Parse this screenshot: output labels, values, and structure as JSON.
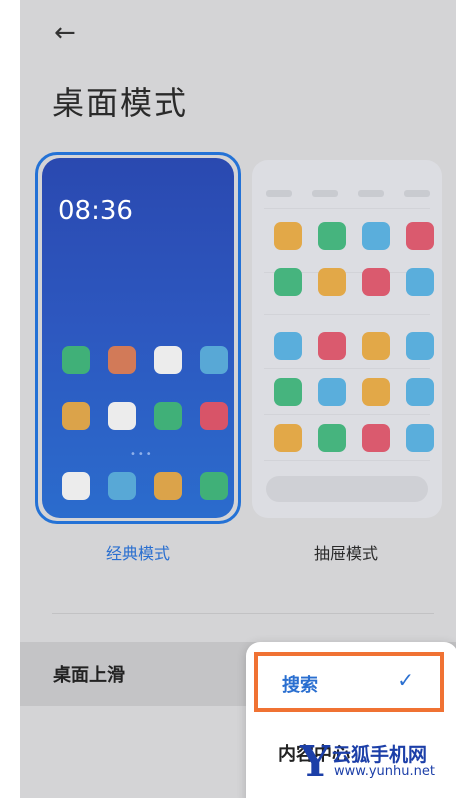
{
  "header": {
    "back_icon": "←",
    "title": "桌面模式"
  },
  "modes": {
    "classic": {
      "label": "经典模式",
      "selected": true,
      "clock": "08:36",
      "page_dots": "•••",
      "icon_rows": [
        [
          "#40b078",
          "#d27a58",
          "#ececec",
          "#58a8d6"
        ],
        [
          "#dba34a",
          "#ececec",
          "#40b078",
          "#d85468"
        ],
        [
          "#ececec",
          "#58a8d6",
          "#dba34a",
          "#40b078"
        ]
      ]
    },
    "drawer": {
      "label": "抽屉模式",
      "selected": false,
      "icon_rows": [
        [
          "#e2a848",
          "#46b47e",
          "#5aaedc",
          "#da5a6e"
        ],
        [
          "#46b47e",
          "#e2a848",
          "#da5a6e",
          "#5aaedc"
        ],
        [
          "#5aaedc",
          "#da5a6e",
          "#e2a848",
          "#5aaedc"
        ],
        [
          "#46b47e",
          "#5aaedc",
          "#e2a848",
          "#5aaedc"
        ],
        [
          "#e2a848",
          "#46b47e",
          "#da5a6e",
          "#5aaedc"
        ]
      ]
    }
  },
  "setting": {
    "label": "桌面上滑"
  },
  "menu": {
    "options": [
      {
        "label": "搜索",
        "selected": true,
        "check": "✓"
      },
      {
        "label": "内容中心"
      }
    ]
  },
  "watermark": {
    "logo": "Y",
    "brand": "云狐手机网",
    "url": "www.yunhu.net"
  },
  "colors": {
    "accent": "#2a6fd0",
    "highlight_border": "#f07233"
  }
}
